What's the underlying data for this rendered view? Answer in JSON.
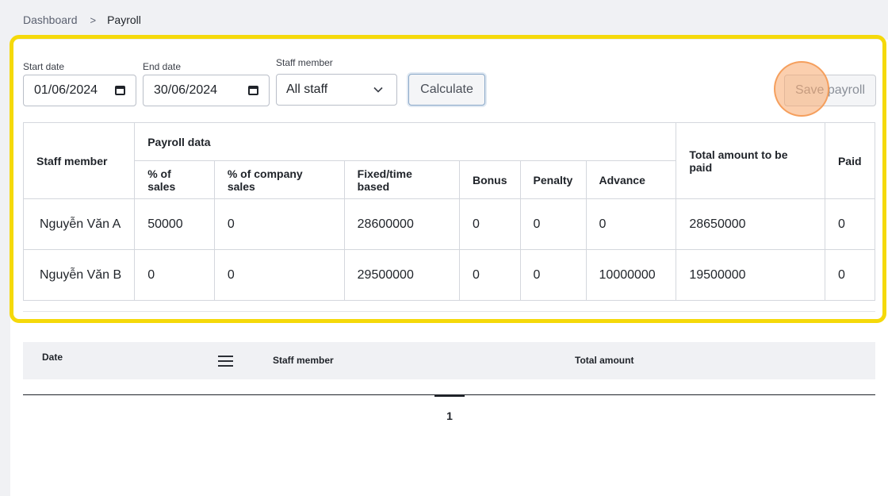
{
  "breadcrumb": {
    "items": [
      {
        "label": "Dashboard"
      },
      {
        "label": "Payroll"
      }
    ],
    "separator": ">"
  },
  "filters": {
    "start_date": {
      "label": "Start date",
      "value": "01/06/2024"
    },
    "end_date": {
      "label": "End date",
      "value": "30/06/2024"
    },
    "staff_member": {
      "label": "Staff member",
      "value": "All staff"
    },
    "calculate_label": "Calculate",
    "save_label": "Save payroll"
  },
  "payroll_table": {
    "staff_header": "Staff member",
    "group_header": "Payroll data",
    "sub_headers": [
      "% of sales",
      "% of company sales",
      "Fixed/time based",
      "Bonus",
      "Penalty",
      "Advance"
    ],
    "total_header": "Total amount to be paid",
    "paid_header": "Paid",
    "rows": [
      {
        "name": "Nguyễn Văn A",
        "pct_sales": "50000",
        "pct_company_sales": "0",
        "fixed": "28600000",
        "bonus": "0",
        "penalty": "0",
        "advance": "0",
        "total": "28650000",
        "paid": "0"
      },
      {
        "name": "Nguyễn Văn B",
        "pct_sales": "0",
        "pct_company_sales": "0",
        "fixed": "29500000",
        "bonus": "0",
        "penalty": "0",
        "advance": "10000000",
        "total": "19500000",
        "paid": "0"
      }
    ]
  },
  "history_table": {
    "headers": {
      "date": "Date",
      "staff_member": "Staff member",
      "total_amount": "Total amount"
    },
    "menu_icon": "hamburger-menu-icon"
  },
  "pagination": {
    "current_page": "1"
  },
  "colors": {
    "highlight": "#f5d90a",
    "click_marker": "#f7a86c"
  }
}
